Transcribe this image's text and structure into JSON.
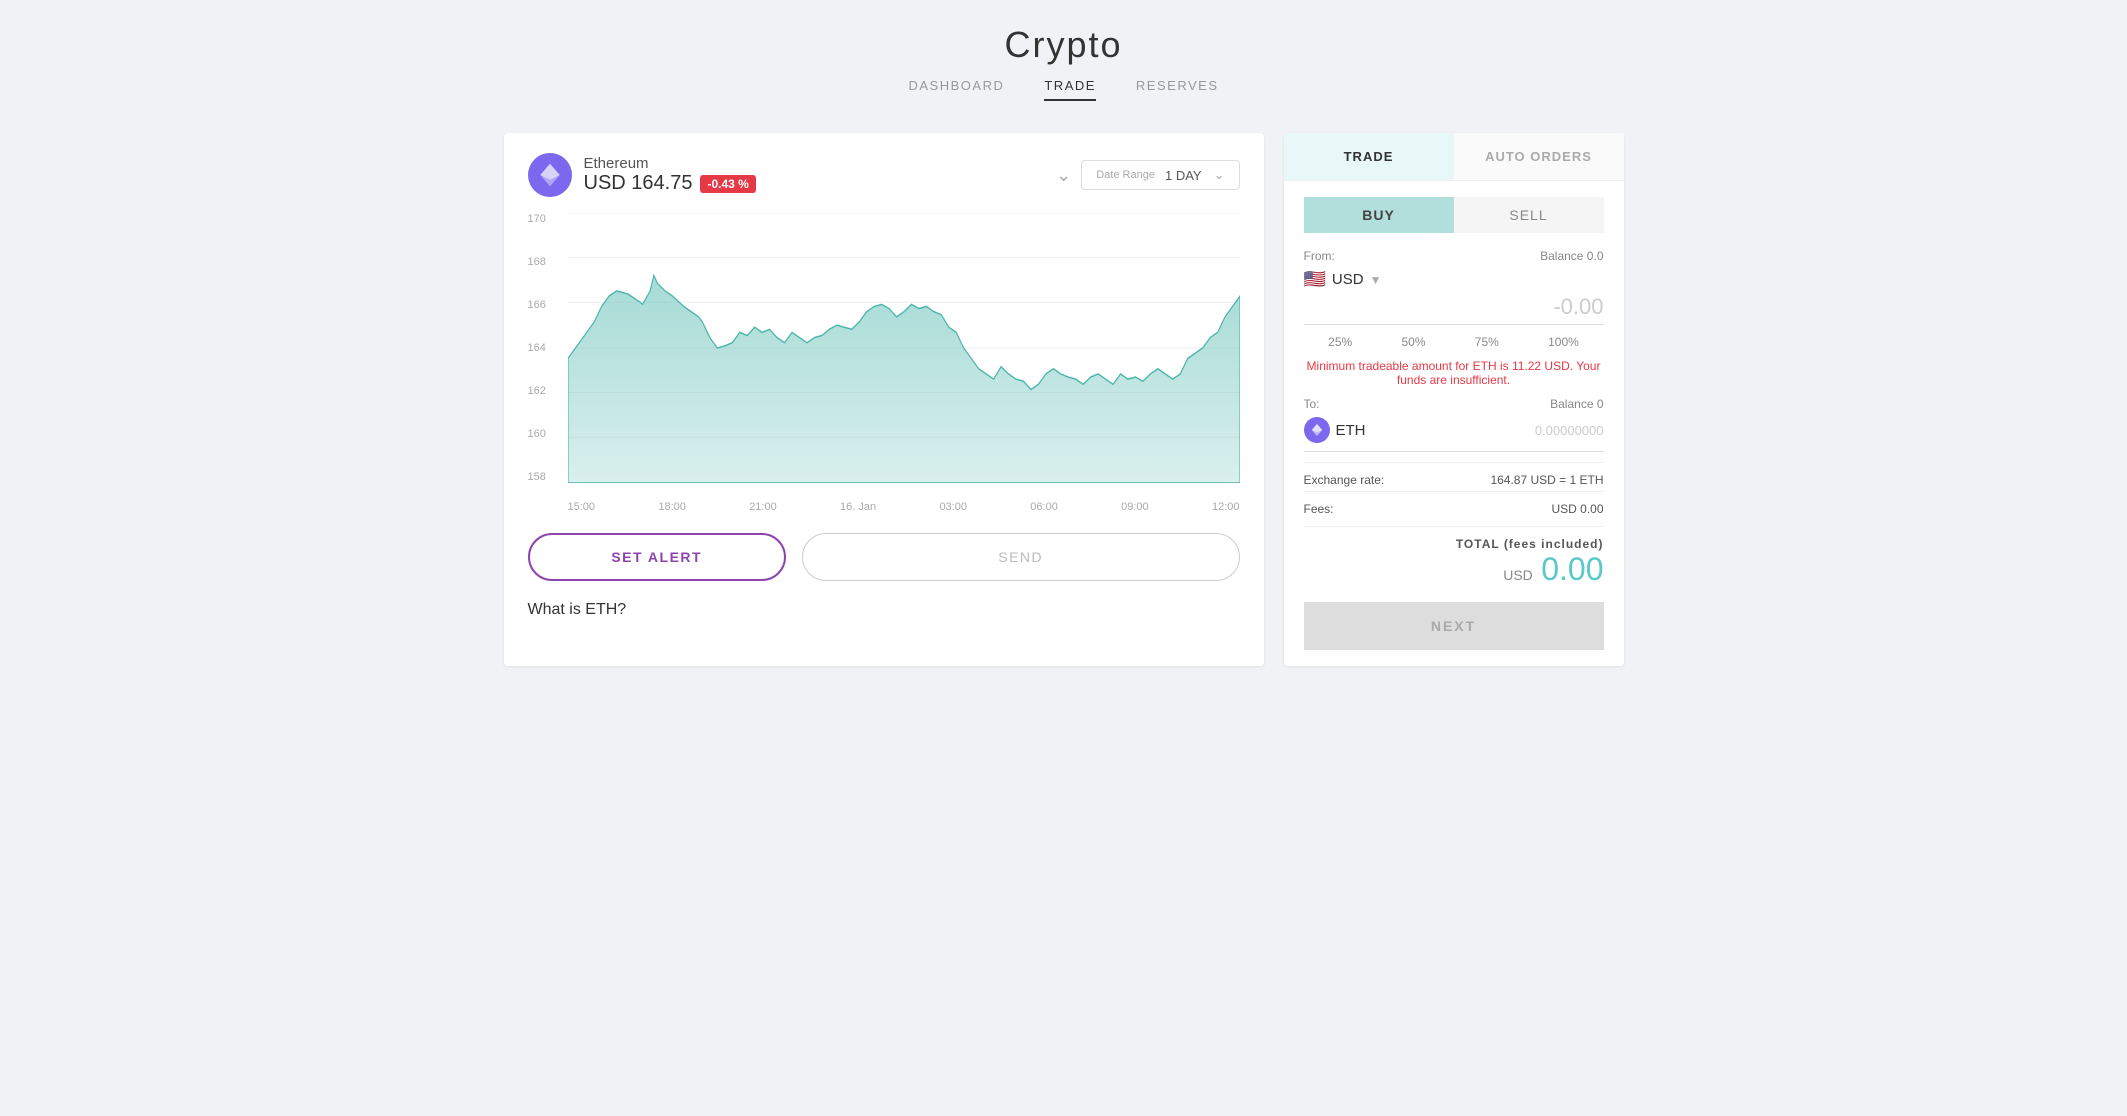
{
  "header": {
    "title": "Crypto",
    "nav": [
      {
        "label": "DASHBOARD",
        "active": false
      },
      {
        "label": "TRADE",
        "active": true
      },
      {
        "label": "RESERVES",
        "active": false
      }
    ]
  },
  "chart_panel": {
    "coin": {
      "name": "Ethereum",
      "symbol": "ETH",
      "price_label": "USD 164.75",
      "change": "-0.43 %"
    },
    "date_range": {
      "label": "Date Range",
      "value": "1 DAY"
    },
    "y_labels": [
      "170",
      "168",
      "166",
      "164",
      "162",
      "160",
      "158"
    ],
    "x_labels": [
      "15:00",
      "18:00",
      "21:00",
      "16. Jan",
      "03:00",
      "06:00",
      "09:00",
      "12:00"
    ],
    "buttons": {
      "set_alert": "SET ALERT",
      "send": "SEND"
    },
    "what_is": "What is ETH?"
  },
  "right_panel": {
    "tabs": [
      "TRADE",
      "AUTO ORDERS"
    ],
    "active_tab": "TRADE",
    "buy_sell": [
      "BUY",
      "SELL"
    ],
    "active_trade": "BUY",
    "from": {
      "label": "From:",
      "balance_label": "Balance 0.0",
      "currency": "USD",
      "amount": "-0.00"
    },
    "percentages": [
      "25%",
      "50%",
      "75%",
      "100%"
    ],
    "warning": "Minimum tradeable amount for ETH is 11.22 USD. Your funds are insufficient.",
    "to": {
      "label": "To:",
      "balance_label": "Balance 0",
      "currency": "ETH",
      "amount": "0.00000000"
    },
    "exchange_rate": {
      "label": "Exchange rate:",
      "value": "164.87 USD = 1 ETH"
    },
    "fees": {
      "label": "Fees:",
      "value": "USD 0.00"
    },
    "total": {
      "label": "TOTAL (fees included)",
      "currency": "USD",
      "amount": "0.00"
    },
    "next_button": "NEXT"
  }
}
